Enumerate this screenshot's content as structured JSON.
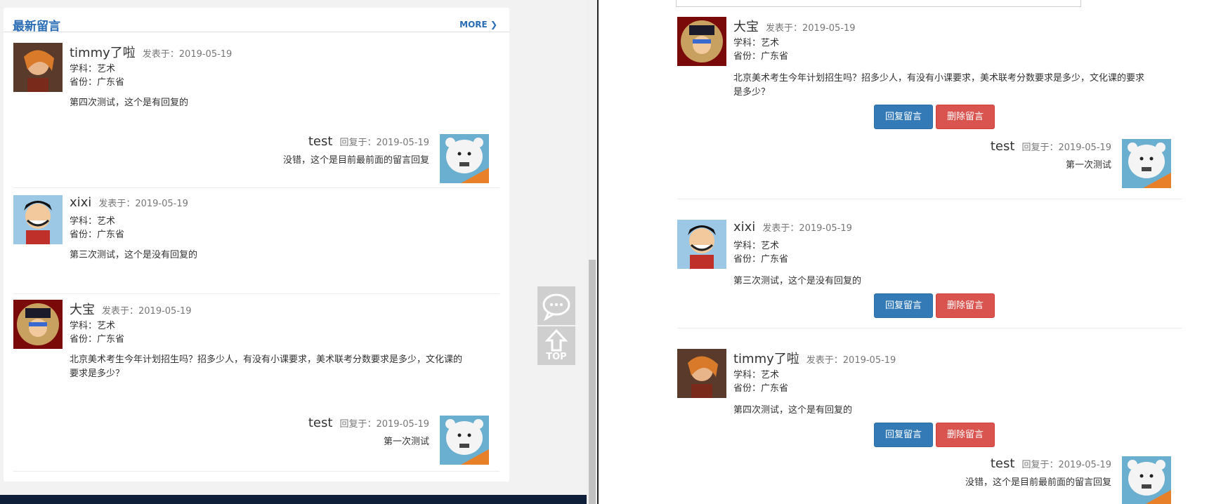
{
  "left": {
    "header": {
      "title": "最新留言",
      "more": "MORE"
    },
    "messages": [
      {
        "name": "timmy了啦",
        "date_label": "发表于：2019-05-19",
        "subject": "学科：艺术",
        "province": "省份：广东省",
        "content": "第四次测试，这个是有回复的",
        "reply": {
          "name": "test",
          "date_label": "回复于：2019-05-19",
          "content": "没错，这个是目前最前面的留言回复"
        }
      },
      {
        "name": "xixi",
        "date_label": "发表于：2019-05-19",
        "subject": "学科：艺术",
        "province": "省份：广东省",
        "content": "第三次测试，这个是没有回复的"
      },
      {
        "name": "大宝",
        "date_label": "发表于：2019-05-19",
        "subject": "学科：艺术",
        "province": "省份：广东省",
        "content_line1": "北京美术考生今年计划招生吗？招多少人，有没有小课要求，美术联考分数要求是多少，文化课的",
        "content_line2": "要求是多少？",
        "reply": {
          "name": "test",
          "date_label": "回复于：2019-05-19",
          "content": "第一次测试"
        }
      }
    ],
    "side": {
      "top_label": "TOP"
    }
  },
  "right": {
    "messages": [
      {
        "name": "大宝",
        "date_label": "发表于：2019-05-19",
        "subject": "学科：艺术",
        "province": "省份：广东省",
        "content_line1": "北京美术考生今年计划招生吗？招多少人，有没有小课要求，美术联考分数要求是多少，文化课的要求",
        "content_line2": "是多少？",
        "reply": {
          "name": "test",
          "date_label": "回复于：2019-05-19",
          "content": "第一次测试"
        }
      },
      {
        "name": "xixi",
        "date_label": "发表于：2019-05-19",
        "subject": "学科：艺术",
        "province": "省份：广东省",
        "content": "第三次测试，这个是没有回复的"
      },
      {
        "name": "timmy了啦",
        "date_label": "发表于：2019-05-19",
        "subject": "学科：艺术",
        "province": "省份：广东省",
        "content": "第四次测试，这个是有回复的",
        "reply": {
          "name": "test",
          "date_label": "回复于：2019-05-19",
          "content": "没错，这个是目前最前面的留言回复"
        }
      }
    ],
    "buttons": {
      "reply": "回复留言",
      "delete": "删除留言"
    }
  },
  "colors": {
    "primary": "#337ab7",
    "danger": "#d9534f",
    "title_blue": "#2a6db5"
  }
}
